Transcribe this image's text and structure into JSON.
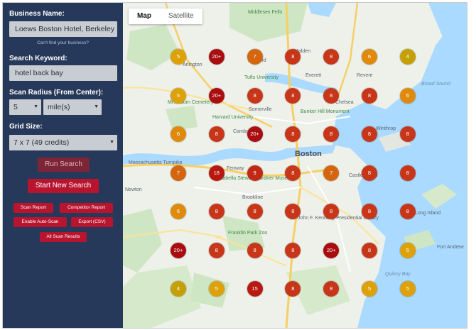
{
  "panel": {
    "business_label": "Business Name:",
    "business_value": "Loews Boston Hotel, Berkeley",
    "cant_find": "Can't find your business?",
    "keyword_label": "Search Keyword:",
    "keyword_value": "hotel back bay",
    "radius_label": "Scan Radius (From Center):",
    "radius_value": "5",
    "radius_unit": "mile(s)",
    "grid_label": "Grid Size:",
    "grid_value": "7 x 7 (49 credits)",
    "run_search": "Run Search",
    "start_new_search": "Start New Search",
    "scan_report": "Scan Report",
    "competitor_report": "Competitor Report",
    "enable_auto_scan": "Enable Auto-Scan",
    "export_csv": "Export (CSV)",
    "all_scan_results": "All Scan Results"
  },
  "map": {
    "tab_map": "Map",
    "tab_satellite": "Satellite",
    "labels": {
      "boston": "Boston",
      "arlington": "Arlington",
      "medford": "Medford",
      "malden": "Malden",
      "everett": "Everett",
      "revere": "Revere",
      "chelsea": "Chelsea",
      "somerville": "Somerville",
      "cambridge": "Cambridge",
      "brookline": "Brookline",
      "newton": "Newton",
      "winthrop": "Winthrop",
      "fenway": "Fenway",
      "quincy_bay": "Quincy Bay",
      "fort_andrew": "Fort Andrew",
      "long_island": "Long Island",
      "broad_sound": "Broad Sound",
      "tufts": "Tufts University",
      "harvard": "Harvard University",
      "mt_auburn": "Mt Auburn Cemetery",
      "bunker_hill": "Bunker Hill Monument",
      "gardner": "Isabella Stewart Gardner Museum",
      "franklin_park": "Franklin Park Zoo",
      "jfk_library": "John F. Kennedy Presidential Library",
      "fells": "Middlesex Fells",
      "castle_island": "Castle Island",
      "mass_pike": "Massachusetts Turnpike"
    }
  },
  "grid": {
    "rows": [
      [
        "5",
        "20+",
        "7",
        "8",
        "8",
        "6",
        "4"
      ],
      [
        "5",
        "20+",
        "8",
        "8",
        "8",
        "8",
        "6"
      ],
      [
        "6",
        "8",
        "20+",
        "8",
        "8",
        "8",
        "8"
      ],
      [
        "7",
        "18",
        "9",
        "8",
        "7",
        "8",
        "8"
      ],
      [
        "6",
        "8",
        "8",
        "8",
        "8",
        "8",
        "8"
      ],
      [
        "20+",
        "8",
        "8",
        "8",
        "20+",
        "8",
        "5"
      ],
      [
        "4",
        "5",
        "15",
        "8",
        "8",
        "5",
        "5"
      ]
    ],
    "colors": {
      "4": "#c4a006",
      "5": "#dda10a",
      "6": "#df8a0d",
      "7": "#d4660f",
      "8": "#c8361a",
      "9": "#c12914",
      "15": "#b81810",
      "18": "#b8170f",
      "20+": "#a90d10"
    }
  }
}
